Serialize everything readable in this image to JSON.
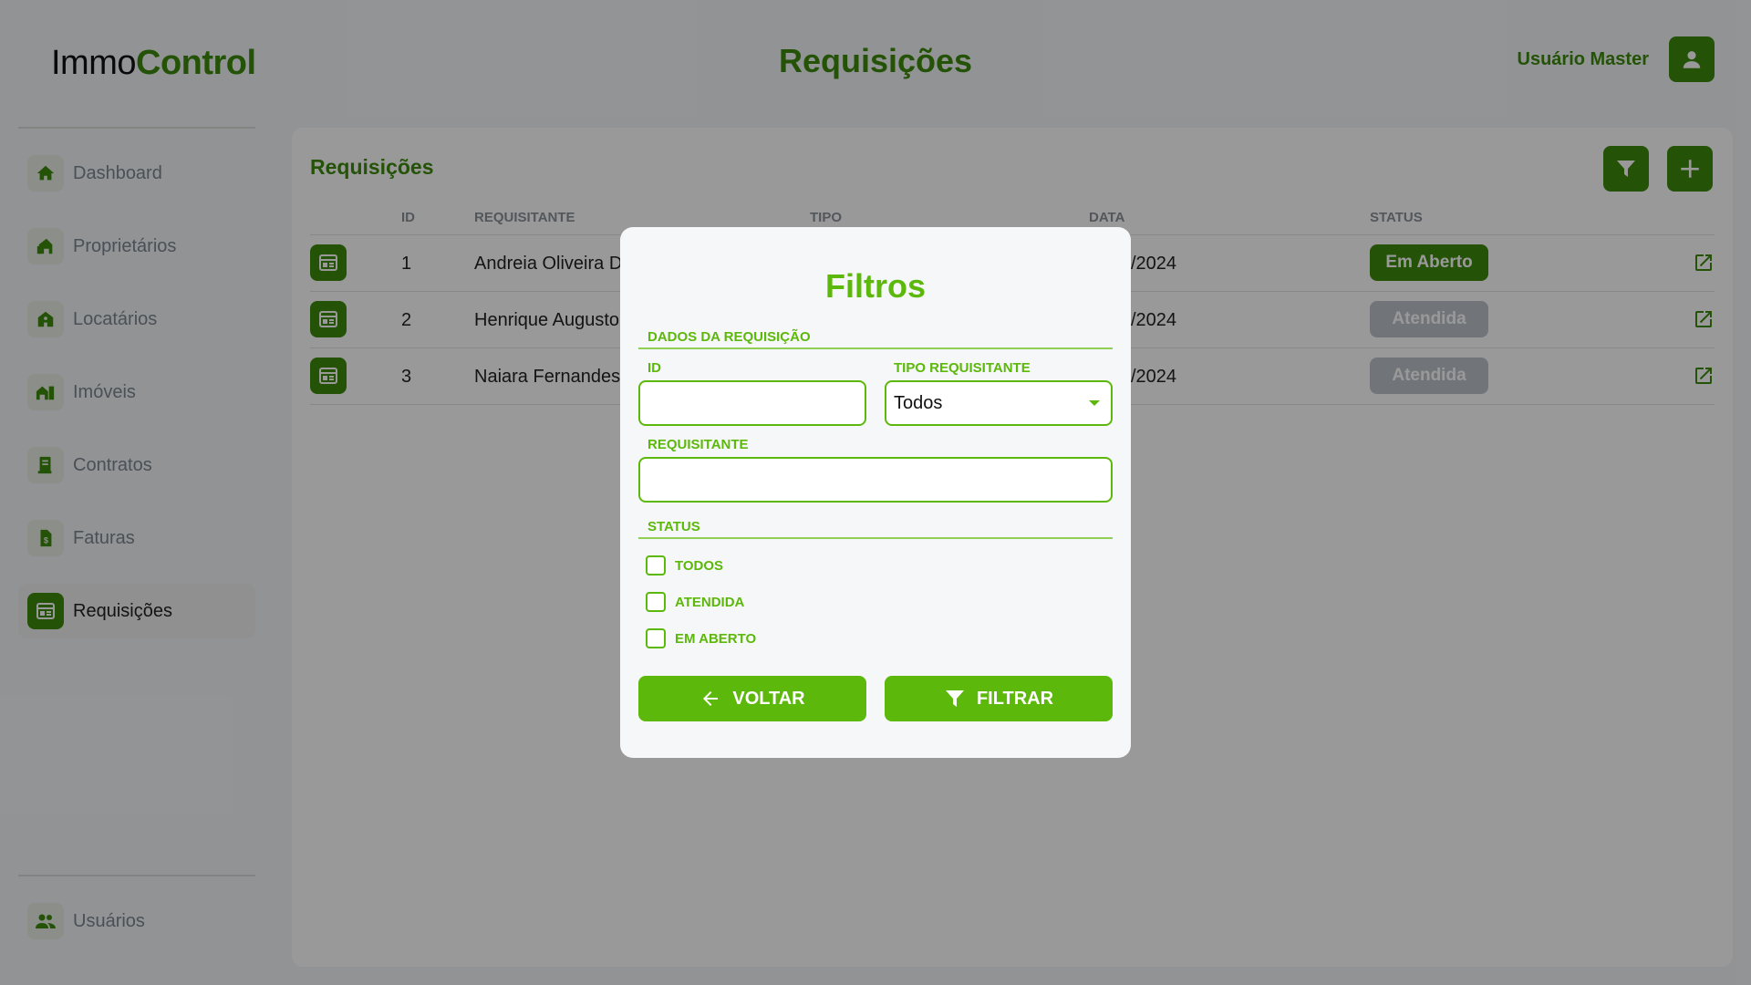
{
  "app": {
    "logo_part1": "Immo",
    "logo_part2": "Control"
  },
  "header": {
    "title": "Requisições",
    "user_name": "Usuário Master",
    "user_icon": "person-icon"
  },
  "sidebar": {
    "items": [
      {
        "label": "Dashboard",
        "icon": "home-icon"
      },
      {
        "label": "Proprietários",
        "icon": "owner-icon"
      },
      {
        "label": "Locatários",
        "icon": "tenant-icon"
      },
      {
        "label": "Imóveis",
        "icon": "building-icon"
      },
      {
        "label": "Contratos",
        "icon": "contract-icon"
      },
      {
        "label": "Faturas",
        "icon": "invoice-icon"
      },
      {
        "label": "Requisições",
        "icon": "request-icon",
        "active": true
      }
    ],
    "footer_item": {
      "label": "Usuários",
      "icon": "users-icon"
    }
  },
  "main": {
    "title": "Requisições",
    "columns": {
      "id": "ID",
      "requester": "REQUISITANTE",
      "type": "TIPO",
      "date": "DATA",
      "status": "STATUS"
    },
    "rows": [
      {
        "id": "1",
        "requester": "Andreia Oliveira Dias",
        "date": "/2024",
        "status": "Em Aberto"
      },
      {
        "id": "2",
        "requester": "Henrique Augusto Co",
        "date": "/2024",
        "status": "Atendida"
      },
      {
        "id": "3",
        "requester": "Naiara Fernandes",
        "date": "/2024",
        "status": "Atendida"
      }
    ]
  },
  "modal": {
    "title": "Filtros",
    "section1": "DADOS DA REQUISIÇÃO",
    "id_label": "ID",
    "id_value": "",
    "type_label": "TIPO REQUISITANTE",
    "type_value": "Todos",
    "requester_label": "REQUISITANTE",
    "requester_value": "",
    "section2": "STATUS",
    "checks": [
      "TODOS",
      "ATENDIDA",
      "EM ABERTO"
    ],
    "back_label": "VOLTAR",
    "filter_label": "FILTRAR"
  },
  "colors": {
    "brand_dark": "#3d8a0c",
    "brand_light": "#5cb80a",
    "status_done": "#bcc4cc"
  }
}
